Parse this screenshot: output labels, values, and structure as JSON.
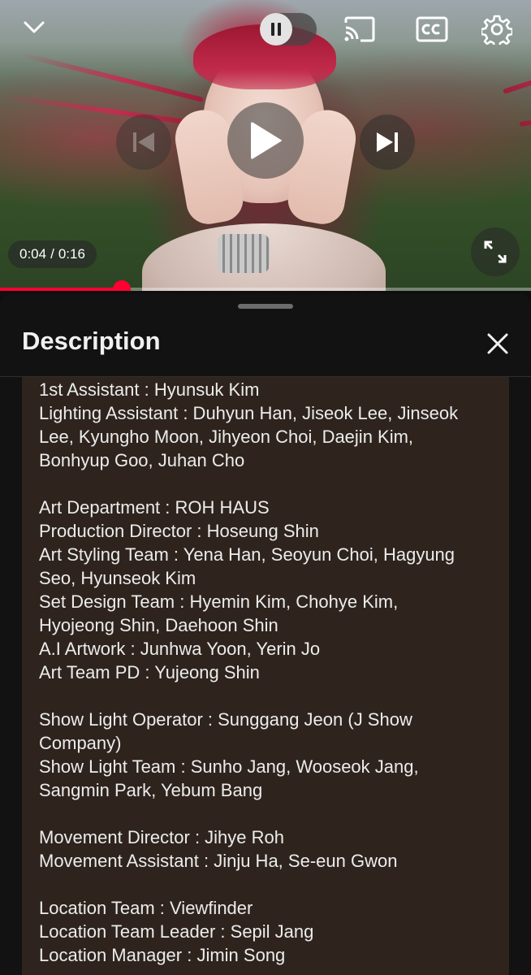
{
  "player": {
    "time_current": "0:04",
    "time_separator": "/",
    "time_total": "0:16",
    "progress_fraction": 0.23,
    "icons": {
      "collapse": "chevron-down-icon",
      "pause": "pause-icon",
      "cast": "cast-icon",
      "captions": "cc-icon",
      "settings": "gear-icon",
      "previous": "skip-previous-icon",
      "play": "play-icon",
      "next": "skip-next-icon",
      "fullscreen": "fullscreen-icon"
    },
    "colors": {
      "progress": "#ff0033"
    }
  },
  "description_sheet": {
    "title": "Description",
    "close_icon": "close-icon",
    "background": "#2e241d",
    "lines": [
      "1st Assistant : Hyunsuk Kim",
      "Lighting Assistant : Duhyun Han, Jiseok Lee, Jinseok",
      "Lee, Kyungho Moon, Jihyeon Choi, Daejin Kim,",
      "Bonhyup Goo, Juhan Cho",
      "",
      "Art Department : ROH HAUS",
      "Production Director : Hoseung Shin",
      "Art Styling Team : Yena Han, Seoyun Choi, Hagyung",
      "Seo, Hyunseok Kim",
      "Set Design Team : Hyemin Kim, Chohye Kim,",
      "Hyojeong Shin, Daehoon Shin",
      "A.I  Artwork : Junhwa Yoon, Yerin Jo",
      "Art Team PD : Yujeong Shin",
      "",
      "Show Light Operator : Sunggang Jeon (J Show",
      "Company)",
      "Show Light Team : Sunho Jang, Wooseok Jang,",
      "Sangmin Park, Yebum Bang",
      "",
      "Movement Director : Jihye Roh",
      "Movement Assistant : Jinju Ha, Se-eun Gwon",
      "",
      "Location Team : Viewfinder",
      "Location Team Leader : Sepil Jang",
      "Location Manager : Jimin Song"
    ]
  }
}
